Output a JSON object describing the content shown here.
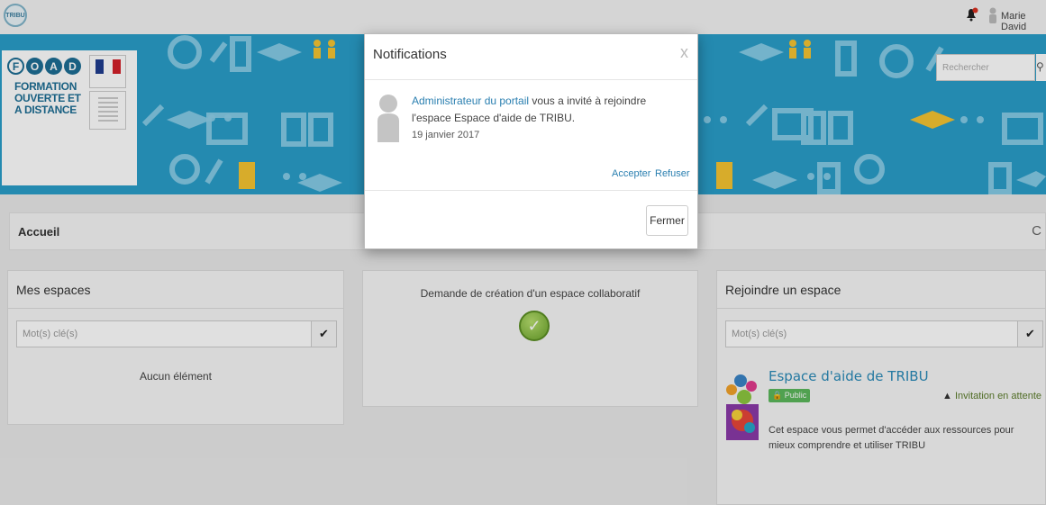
{
  "topbar": {
    "logo_text": "TRIBU",
    "user_name": "Marie David"
  },
  "banner": {
    "foad_letters": [
      "F",
      "O",
      "A",
      "D"
    ],
    "foad_lines": [
      "FORMATION",
      "OUVERTE ET",
      "A DISTANCE"
    ],
    "search_placeholder": "Rechercher"
  },
  "breadcrumb": {
    "label": "Accueil"
  },
  "my_spaces": {
    "title": "Mes espaces",
    "search_placeholder": "Mot(s) clé(s)",
    "empty_text": "Aucun élément"
  },
  "create_space": {
    "title": "Demande de création d'un espace collaboratif"
  },
  "join_space": {
    "title": "Rejoindre un espace",
    "search_placeholder": "Mot(s) clé(s)",
    "space": {
      "name": "Espace d'aide de TRIBU",
      "badge": "Public",
      "status": "Invitation en attente",
      "description": "Cet espace vous permet d'accéder aux ressources pour mieux comprendre et utiliser TRIBU"
    }
  },
  "modal": {
    "title": "Notifications",
    "close_symbol": "x",
    "notification": {
      "actor": "Administrateur du portail",
      "message": " vous a invité à rejoindre l'espace Espace d'aide de TRIBU.",
      "date": "19 janvier 2017",
      "accept_label": "Accepter",
      "refuse_label": "Refuser"
    },
    "close_label": "Fermer"
  },
  "colors": {
    "banner": "#2a9ec9",
    "link": "#2a7fb0",
    "badge": "#5cb85c"
  }
}
